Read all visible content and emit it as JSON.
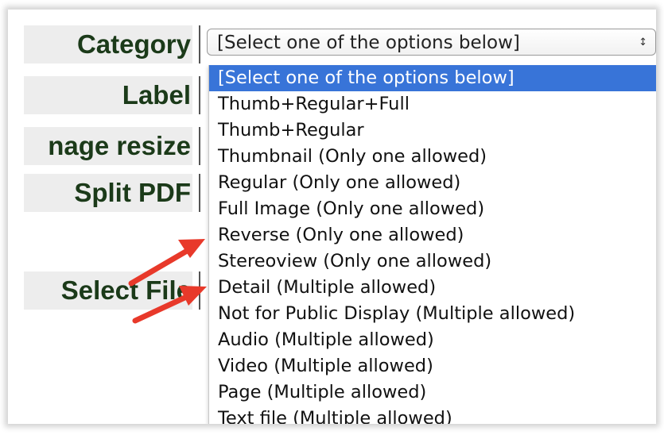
{
  "form": {
    "labels": {
      "category": "Category",
      "label": "Label",
      "image_resize": "nage resize",
      "split_pdf": "Split PDF",
      "select_file": "Select File"
    },
    "category_select": {
      "selected": "[Select one of the options below]",
      "chevron": "↕"
    },
    "category_options": [
      "[Select one of the options below]",
      "Thumb+Regular+Full",
      "Thumb+Regular",
      "Thumbnail (Only one allowed)",
      "Regular (Only one allowed)",
      "Full Image (Only one allowed)",
      "Reverse (Only one allowed)",
      "Stereoview (Only one allowed)",
      "Detail (Multiple allowed)",
      "Not for Public Display (Multiple allowed)",
      "Audio (Multiple allowed)",
      "Video (Multiple allowed)",
      "Page (Multiple allowed)",
      "Text file (Multiple allowed)"
    ]
  },
  "annotations": {
    "arrow_color": "#e8392a",
    "highlight_color": "#3874d8"
  }
}
